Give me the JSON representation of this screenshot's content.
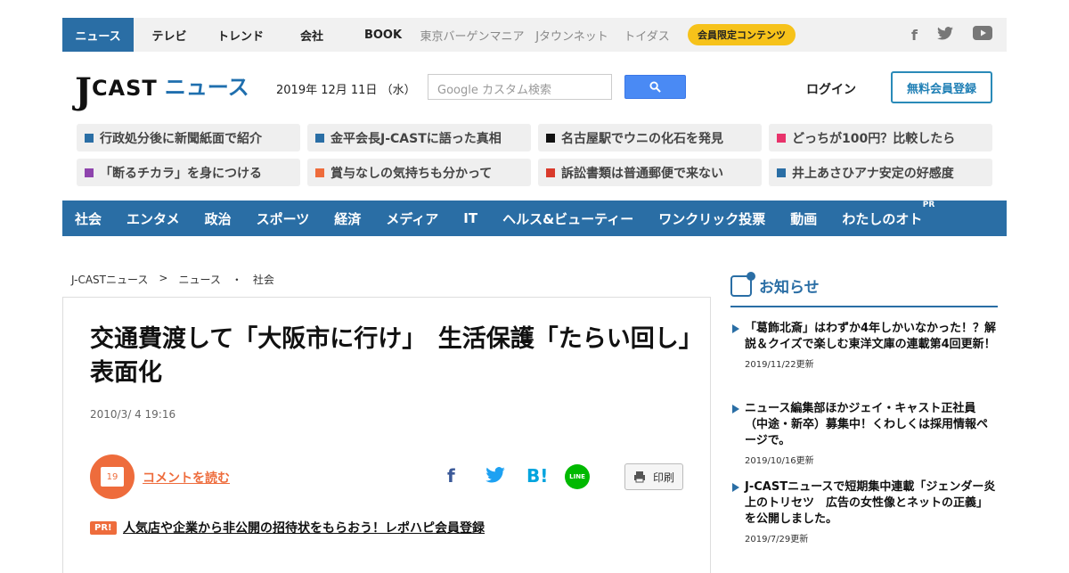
{
  "topnav": {
    "items": [
      {
        "label": "ニュース"
      },
      {
        "label": "テレビ"
      },
      {
        "label": "トレンド"
      },
      {
        "label": "会社"
      },
      {
        "label": "BOOK"
      },
      {
        "label": "東京バーゲンマニア"
      },
      {
        "label": "Jタウンネット"
      },
      {
        "label": "トイダス"
      }
    ],
    "members_badge": "会員限定コンテンツ"
  },
  "header": {
    "logo_j": "J",
    "logo_cast": "CAST",
    "logo_news": "ニュース",
    "date": "2019年 12月 11日 （水）",
    "search_placeholder": "Google カスタム検索",
    "login": "ログイン",
    "register": "無料会員登録"
  },
  "tags": [
    {
      "label": "行政処分後に新聞紙面で紹介",
      "color": "#2a6ea5"
    },
    {
      "label": "金平会長J-CASTに語った真相",
      "color": "#2a6ea5"
    },
    {
      "label": "名古屋駅でウニの化石を発見",
      "color": "#111111"
    },
    {
      "label": "どっちが100円？比較したら",
      "color": "#e8336b"
    },
    {
      "label": "「断るチカラ」を身につける",
      "color": "#8e44ad"
    },
    {
      "label": "賞与なしの気持ちも分かって",
      "color": "#ee6c3c"
    },
    {
      "label": "訴訟書類は普通郵便で来ない",
      "color": "#d93a2b"
    },
    {
      "label": "井上あさひアナ安定の好感度",
      "color": "#2a6ea5"
    }
  ],
  "categories": [
    "社会",
    "エンタメ",
    "政治",
    "スポーツ",
    "経済",
    "メディア",
    "IT",
    "ヘルス&ビューティー",
    "ワンクリック投票",
    "動画",
    "わたしのオト"
  ],
  "categories_pr": "PR",
  "breadcrumb": {
    "home": "J-CASTニュース",
    "sep1": ">",
    "section": "ニュース",
    "sep2": "・",
    "category": "社会"
  },
  "article": {
    "title": "交通費渡して「大阪市に行け」　生活保護「たらい回し」表面化",
    "date": "2010/3/ 4 19:16",
    "comment_count": "19",
    "comment_link": "コメントを読む",
    "share_hatena": "B!",
    "share_line": "LINE",
    "print": "印刷",
    "pr_tag": "PR!",
    "pr_link": "人気店や企業から非公開の招待状をもらおう！レポハピ会員登録"
  },
  "sidebar": {
    "heading": "お知らせ",
    "items": [
      {
        "title": "「葛飾北斎」はわずか4年しかいなかった！？解説＆クイズで楽しむ東洋文庫の連載第4回更新！",
        "updated": "2019/11/22更新"
      },
      {
        "title": "ニュース編集部ほかジェイ・キャスト正社員（中途・新卒）募集中！くわしくは採用情報ページで。",
        "updated": "2019/10/16更新"
      },
      {
        "title": "J-CASTニュースで短期集中連載「ジェンダー炎上のトリセツ　広告の女性像とネットの正義」を公開しました。",
        "updated": "2019/7/29更新"
      }
    ]
  },
  "colors": {
    "brand_blue": "#2a6ea5",
    "accent_orange": "#ee6c3c",
    "badge_yellow": "#f6c21a"
  }
}
